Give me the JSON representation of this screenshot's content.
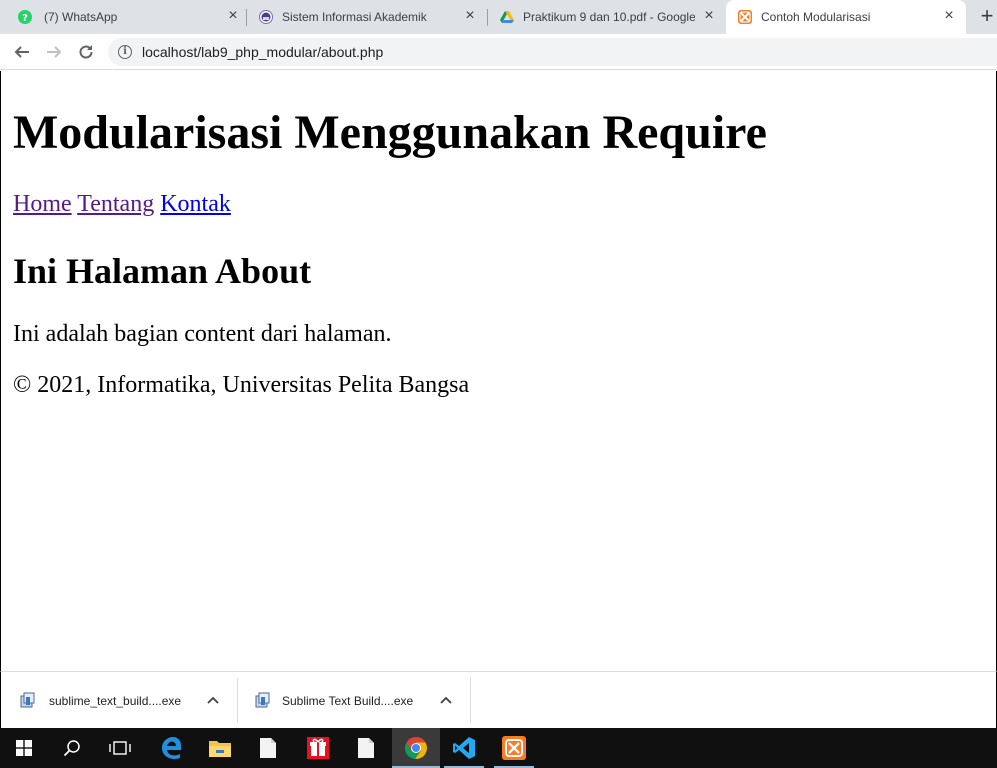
{
  "browser": {
    "tabs": [
      {
        "title": "(7) WhatsApp",
        "icon": "whatsapp-icon",
        "active": false
      },
      {
        "title": "Sistem Informasi Akademik",
        "icon": "academic-logo-icon",
        "active": false
      },
      {
        "title": "Praktikum 9 dan 10.pdf - Google",
        "icon": "google-drive-icon",
        "active": false
      },
      {
        "title": "Contoh Modularisasi",
        "icon": "xampp-icon",
        "active": true
      }
    ],
    "new_tab_label": "+",
    "close_label": "×",
    "url": "localhost/lab9_php_modular/about.php"
  },
  "page": {
    "heading": "Modularisasi Menggunakan Require",
    "nav": [
      {
        "label": "Home"
      },
      {
        "label": "Tentang"
      },
      {
        "label": "Kontak"
      }
    ],
    "subheading": "Ini Halaman About",
    "body_text": "Ini adalah bagian content dari halaman.",
    "footer_text": "© 2021, Informatika, Universitas Pelita Bangsa"
  },
  "downloads": [
    {
      "filename": "sublime_text_build....exe"
    },
    {
      "filename": "Sublime Text Build....exe"
    }
  ],
  "taskbar": {
    "items": [
      "windows-start",
      "search",
      "task-view",
      "edge",
      "file-explorer",
      "file",
      "gift-app",
      "file",
      "chrome",
      "vscode",
      "xampp"
    ]
  },
  "colors": {
    "tabstrip_bg": "#dee1e6",
    "omnibox_bg": "#f1f3f4",
    "link_unvisited": "#0000ee",
    "link_visited": "#551a8b",
    "taskbar_bg": "#101010"
  }
}
